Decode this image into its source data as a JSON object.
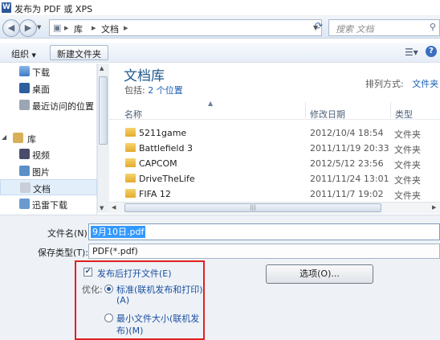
{
  "window": {
    "title": "发布为 PDF 或 XPS",
    "app_icon": "W"
  },
  "address": {
    "path": [
      "库",
      "文档"
    ],
    "search_placeholder": "搜索 文档"
  },
  "toolbar": {
    "organize": "组织",
    "new_folder": "新建文件夹"
  },
  "sidebar": {
    "items": [
      {
        "label": "下载",
        "icon": "download-folder-icon"
      },
      {
        "label": "桌面",
        "icon": "desktop-icon"
      },
      {
        "label": "最近访问的位置",
        "icon": "recent-places-icon"
      },
      {
        "label": "库",
        "icon": "library-icon"
      },
      {
        "label": "视频",
        "icon": "videos-icon"
      },
      {
        "label": "图片",
        "icon": "pictures-icon"
      },
      {
        "label": "文档",
        "icon": "documents-icon"
      },
      {
        "label": "迅雷下载",
        "icon": "thunder-download-icon"
      }
    ]
  },
  "library": {
    "title": "文档库",
    "includes_prefix": "包括:",
    "includes_link": "2 个位置",
    "arrange_label": "排列方式:",
    "arrange_value": "文件夹"
  },
  "columns": {
    "name": "名称",
    "modified": "修改日期",
    "type": "类型"
  },
  "files": [
    {
      "name": "5211game",
      "date": "2012/10/4 18:54",
      "type": "文件夹"
    },
    {
      "name": "Battlefield 3",
      "date": "2011/11/19 20:33",
      "type": "文件夹"
    },
    {
      "name": "CAPCOM",
      "date": "2012/5/12 23:56",
      "type": "文件夹"
    },
    {
      "name": "DriveTheLife",
      "date": "2011/11/24 13:01",
      "type": "文件夹"
    },
    {
      "name": "FIFA 12",
      "date": "2011/11/7 19:02",
      "type": "文件夹"
    }
  ],
  "form": {
    "filename_label": "文件名(N):",
    "filename_value": "9月10日.pdf",
    "savetype_label": "保存类型(T):",
    "savetype_value": "PDF(*.pdf)"
  },
  "options": {
    "open_after": "发布后打开文件(E)",
    "optimize_label": "优化:",
    "std_line1": "标准(联机发布和打印)",
    "std_line2": "(A)",
    "min_line1": "最小文件大小(联机发",
    "min_line2": "布)(M)",
    "options_button": "选项(O)..."
  },
  "colors": {
    "library_title": "#1e5a8c",
    "link": "#1a5fb4",
    "highlight_box": "#e02020",
    "selection": "#3399ff"
  }
}
